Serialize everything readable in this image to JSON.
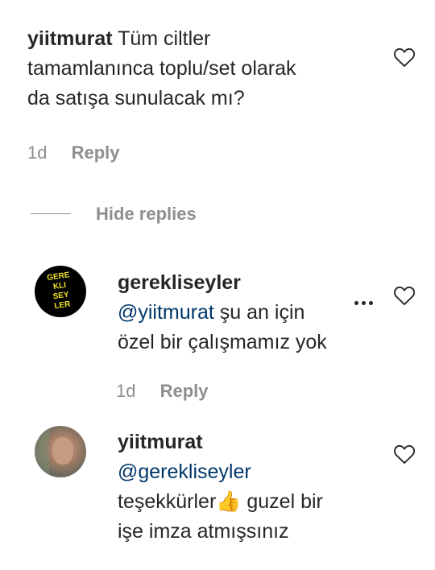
{
  "comments": [
    {
      "username": "yiitmurat",
      "text_line1": "Tüm ciltler",
      "text_line2": "tamamlanınca toplu/set olarak",
      "text_line3": "da satışa sunulacak mı?",
      "time": "1d",
      "reply_label": "Reply"
    }
  ],
  "hide_replies_label": "Hide replies",
  "replies": [
    {
      "username": "gerekliseyler",
      "avatar_text": [
        "GERE",
        "KLI",
        "SEY",
        "LER"
      ],
      "mention": "@yiitmurat",
      "text_after_mention": " şu an için",
      "text_line2": "özel bir çalışmamız yok",
      "time": "1d",
      "reply_label": "Reply"
    },
    {
      "username": "yiitmurat",
      "mention": "@gerekliseyler",
      "text_line2_a": "teşekkürler",
      "emoji": "👍",
      "text_line2_b": " guzel bir",
      "text_line3": "işe imza atmışsınız"
    }
  ],
  "icons": {
    "heart": "heart-outline-icon",
    "more": "more-dots-icon"
  }
}
